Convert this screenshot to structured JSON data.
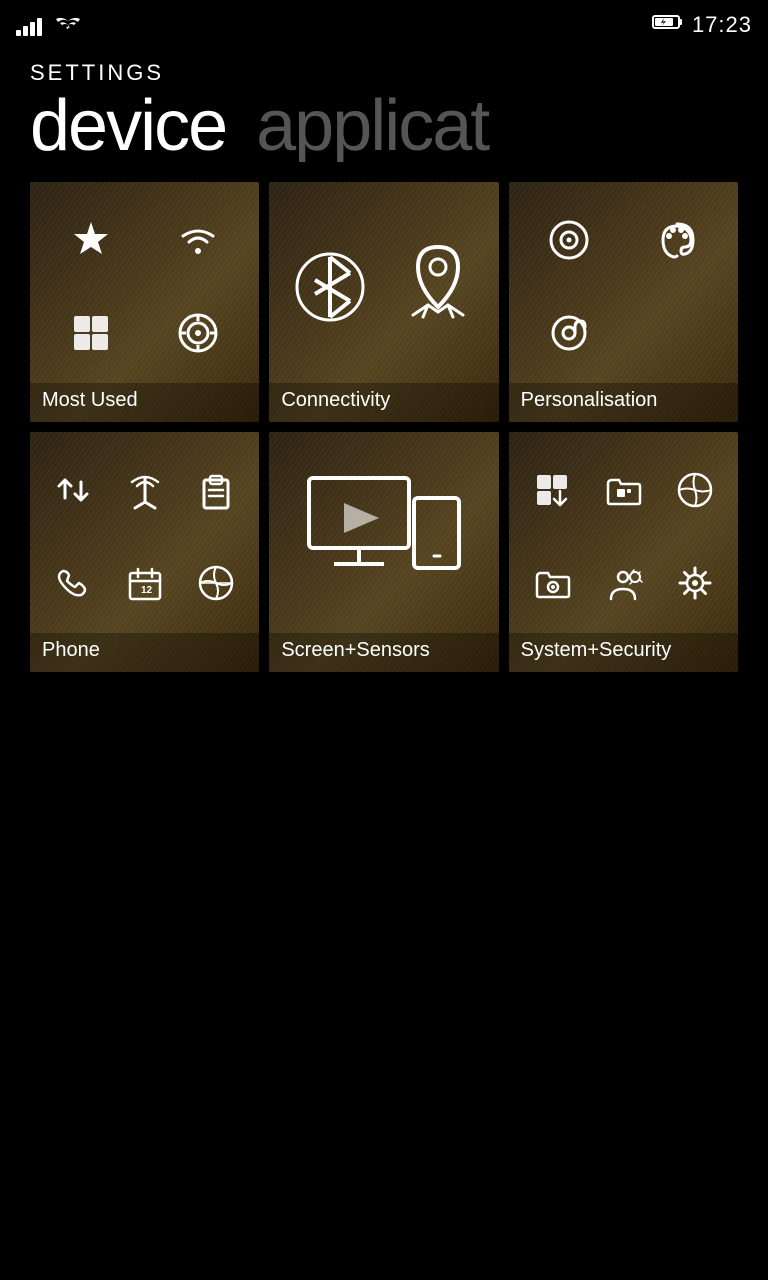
{
  "statusBar": {
    "time": "17:23",
    "batteryIcon": "🔋",
    "signalBars": 4,
    "wifiStrength": 3
  },
  "header": {
    "settingsLabel": "SETTINGS",
    "activeTab": "device",
    "inactiveTab": "applicat"
  },
  "tiles": [
    {
      "id": "most-used",
      "label": "Most Used",
      "icons": [
        "star-apps",
        "wifi-small",
        "music-note-small",
        "apps-grid"
      ]
    },
    {
      "id": "connectivity",
      "label": "Connectivity",
      "icons": [
        "bluetooth",
        "location-arrows"
      ]
    },
    {
      "id": "personalisation",
      "label": "Personalisation",
      "icons": [
        "music-circle",
        "palette",
        "at-sign",
        "empty"
      ]
    },
    {
      "id": "phone",
      "label": "Phone",
      "icons": [
        "data-transfer",
        "antenna",
        "clipboard",
        "phone-call",
        "calendar",
        "world-map"
      ]
    },
    {
      "id": "screen-sensors",
      "label": "Screen+Sensors",
      "icons": [
        "screen-devices"
      ]
    },
    {
      "id": "system-security",
      "label": "System+Security",
      "icons": [
        "app-install",
        "folder-apps",
        "globe",
        "folder-settings",
        "gear-user",
        "gear-wrench"
      ]
    }
  ]
}
